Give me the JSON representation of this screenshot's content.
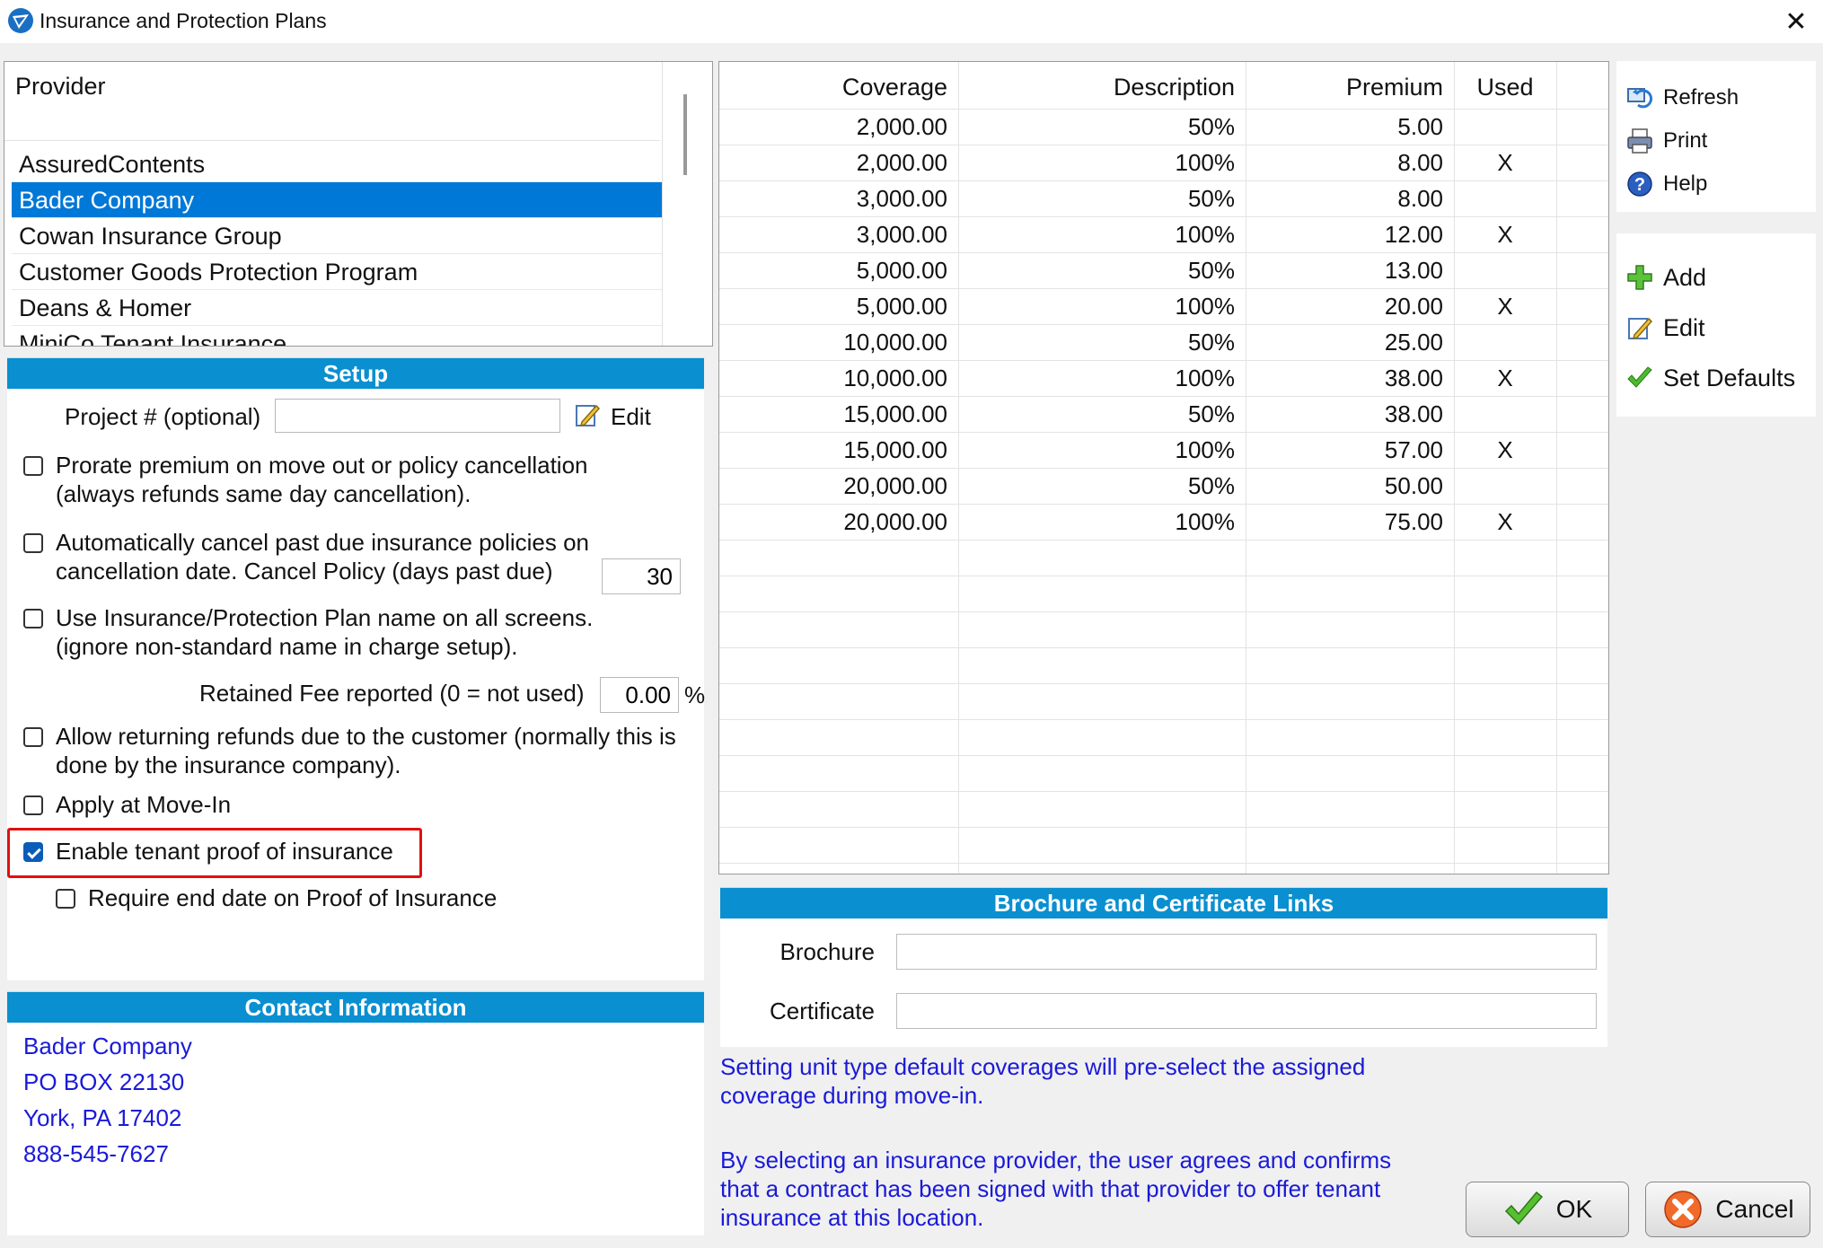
{
  "window": {
    "title": "Insurance and Protection Plans",
    "close_glyph": "✕"
  },
  "providers": {
    "header": "Provider",
    "items": [
      "AssuredContents",
      "Bader Company",
      "Cowan Insurance Group",
      "Customer Goods Protection Program",
      "Deans & Homer",
      "MiniCo Tenant Insurance"
    ],
    "selected_index": 1
  },
  "setup": {
    "title": "Setup",
    "project_label": "Project # (optional)",
    "project_value": "",
    "edit_label": "Edit",
    "prorate": {
      "line1": "Prorate premium on move out or policy cancellation",
      "line2": "(always refunds same day cancellation).",
      "checked": false
    },
    "autocancel": {
      "line1": "Automatically cancel past due insurance policies on",
      "line2": "cancellation date. Cancel Policy (days past due)",
      "days": "30",
      "checked": false
    },
    "use_name": {
      "line1": "Use Insurance/Protection Plan name on all screens.",
      "line2": "(ignore non-standard name in charge setup).",
      "checked": false
    },
    "retained_fee_label": "Retained Fee reported (0 = not used)",
    "retained_fee_value": "0.00",
    "retained_fee_unit": "%",
    "allow_refunds": {
      "line1": "Allow returning refunds due to the customer (normally this is",
      "line2": "done by the insurance company).",
      "checked": false
    },
    "apply_movein": {
      "label": "Apply at Move-In",
      "checked": false
    },
    "enable_proof": {
      "label": "Enable tenant proof of insurance",
      "checked": true
    },
    "require_end": {
      "label": "Require end date on Proof of Insurance",
      "checked": false
    }
  },
  "contact": {
    "title": "Contact Information",
    "lines": [
      "Bader Company",
      "PO BOX 22130",
      "York, PA  17402",
      "888-545-7627"
    ]
  },
  "coverage": {
    "columns": [
      "Coverage",
      "Description",
      "Premium",
      "Used"
    ],
    "rows": [
      [
        "2,000.00",
        "50%",
        "5.00",
        ""
      ],
      [
        "2,000.00",
        "100%",
        "8.00",
        "X"
      ],
      [
        "3,000.00",
        "50%",
        "8.00",
        ""
      ],
      [
        "3,000.00",
        "100%",
        "12.00",
        "X"
      ],
      [
        "5,000.00",
        "50%",
        "13.00",
        ""
      ],
      [
        "5,000.00",
        "100%",
        "20.00",
        "X"
      ],
      [
        "10,000.00",
        "50%",
        "25.00",
        ""
      ],
      [
        "10,000.00",
        "100%",
        "38.00",
        "X"
      ],
      [
        "15,000.00",
        "50%",
        "38.00",
        ""
      ],
      [
        "15,000.00",
        "100%",
        "57.00",
        "X"
      ],
      [
        "20,000.00",
        "50%",
        "50.00",
        ""
      ],
      [
        "20,000.00",
        "100%",
        "75.00",
        "X"
      ]
    ]
  },
  "tools": {
    "refresh": "Refresh",
    "print": "Print",
    "help": "Help",
    "add": "Add",
    "edit": "Edit",
    "set_defaults": "Set Defaults"
  },
  "links": {
    "title": "Brochure and Certificate Links",
    "brochure_label": "Brochure",
    "brochure_value": "",
    "certificate_label": "Certificate",
    "certificate_value": ""
  },
  "notes": {
    "defaults_line1": "Setting unit type default coverages will pre-select the assigned",
    "defaults_line2": "coverage during move-in.",
    "agree_line1": "By selecting an insurance provider, the user agrees and confirms",
    "agree_line2": "that a contract has been signed with that provider to offer tenant",
    "agree_line3": "insurance at this location."
  },
  "buttons": {
    "ok": "OK",
    "cancel": "Cancel"
  },
  "colors": {
    "section_header": "#0a8fd0",
    "selection": "#0078d7",
    "link_text": "#1a1ad8",
    "highlight": "#e01010"
  }
}
